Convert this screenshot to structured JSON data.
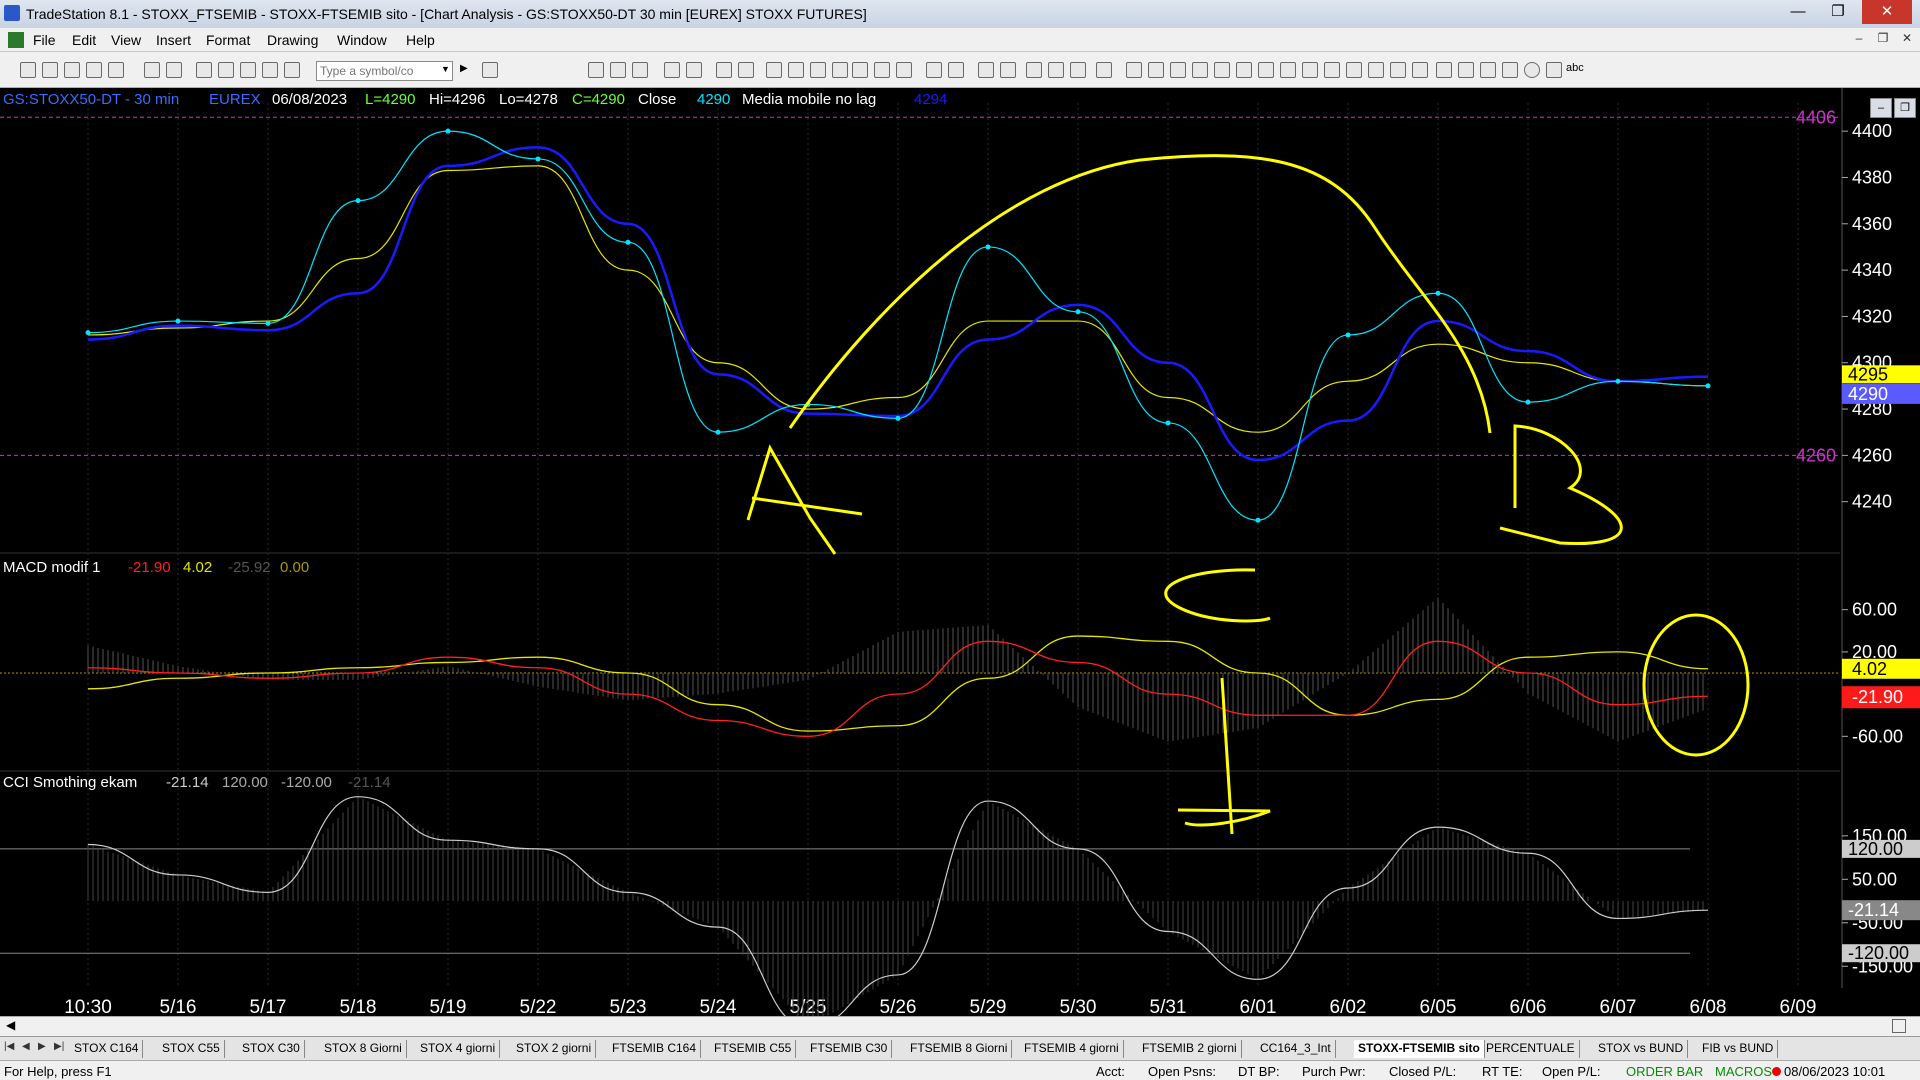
{
  "window": {
    "title": "TradeStation 8.1 - STOXX_FTSEMIB - STOXX-FTSEMIB sito - [Chart Analysis - GS:STOXX50-DT  30 min  [EUREX] STOXX FUTURES]",
    "minimize": "—",
    "maximize": "❐",
    "close": "✕"
  },
  "menu": [
    "File",
    "Edit",
    "View",
    "Insert",
    "Format",
    "Drawing",
    "Window",
    "Help"
  ],
  "mdi_controls": [
    "–",
    "❐",
    "✕"
  ],
  "toolbar": {
    "symbol_placeholder": "Type a symbol/co",
    "text_tool": "abc"
  },
  "chart_header": {
    "symbol": "GS:STOXX50-DT - 30 min",
    "exchange": "EUREX",
    "date": "06/08/2023",
    "last": "L=4290",
    "high": "Hi=4296",
    "low": "Lo=4278",
    "close": "C=4290",
    "close_label": "Close",
    "close_value": "4290",
    "study": "Media mobile no lag",
    "study_value": "4294"
  },
  "macd_header": {
    "name": "MACD modif 1",
    "v1": "-21.90",
    "v2": "4.02",
    "v3": "-25.92",
    "v4": "0.00"
  },
  "cci_header": {
    "name": "CCI Smothing ekam",
    "v1": "-21.14",
    "v2": "120.00",
    "v3": "-120.00",
    "v4": "-21.14"
  },
  "colors": {
    "price": "#00e5ff",
    "ma_fast": "#1a1aff",
    "ma_slow": "#e6e600",
    "macd": "#ff2020",
    "signal": "#e6e600",
    "cci_up": "#ff2020",
    "cci_down": "#19c9d8",
    "annotation": "#ffff00",
    "ref_level": "#cc33cc"
  },
  "chart_data": [
    {
      "type": "line",
      "title": "GS:STOXX50-DT - 30 min",
      "x": [
        "10:30",
        "5/16",
        "5/17",
        "5/18",
        "5/19",
        "5/22",
        "5/23",
        "5/24",
        "5/25",
        "5/26",
        "5/29",
        "5/30",
        "5/31",
        "6/01",
        "6/02",
        "6/05",
        "6/06",
        "6/07",
        "6/08",
        "6/09"
      ],
      "series": [
        {
          "name": "Close",
          "values": [
            4313,
            4318,
            4317,
            4370,
            4400,
            4388,
            4352,
            4270,
            4282,
            4276,
            4350,
            4322,
            4274,
            4232,
            4312,
            4330,
            4283,
            4292,
            4290,
            null
          ]
        },
        {
          "name": "Media mobile no lag",
          "values": [
            4310,
            4316,
            4314,
            4330,
            4385,
            4393,
            4360,
            4295,
            4278,
            4277,
            4310,
            4325,
            4300,
            4258,
            4275,
            4318,
            4305,
            4292,
            4294,
            null
          ]
        },
        {
          "values": [
            4312,
            4315,
            4318,
            4345,
            4383,
            4385,
            4340,
            4300,
            4280,
            4285,
            4318,
            4318,
            4285,
            4270,
            4292,
            4308,
            4300,
            4292,
            4290,
            null
          ]
        }
      ],
      "ylim": [
        4220,
        4410
      ],
      "y_ticks": [
        4240,
        4260,
        4280,
        4300,
        4320,
        4340,
        4360,
        4380,
        4400
      ],
      "reference_lines": [
        4260,
        4406
      ],
      "price_labels": [
        "4406",
        "4260",
        "4295",
        "4290"
      ]
    },
    {
      "type": "line",
      "title": "MACD modif 1",
      "series": [
        {
          "values": [
            5,
            0,
            -5,
            0,
            15,
            5,
            -20,
            -45,
            -60,
            -20,
            30,
            10,
            -20,
            -40,
            -40,
            30,
            0,
            -30,
            -22
          ]
        },
        {
          "values": [
            -15,
            -5,
            0,
            5,
            10,
            15,
            0,
            -30,
            -55,
            -50,
            -5,
            35,
            30,
            0,
            -40,
            -25,
            15,
            20,
            4
          ]
        }
      ],
      "ylim": [
        -90,
        90
      ],
      "y_ticks": [
        "60.00",
        "20.00",
        "-60.00"
      ],
      "value_labels": [
        "4.02",
        "-21.90"
      ]
    },
    {
      "type": "line",
      "title": "CCI Smothing ekam",
      "series": [
        {
          "values": [
            130,
            60,
            20,
            240,
            140,
            120,
            20,
            -60,
            -290,
            -170,
            230,
            120,
            -70,
            -180,
            30,
            170,
            110,
            -40,
            -21
          ]
        }
      ],
      "ylim": [
        -200,
        260
      ],
      "y_ticks": [
        "150.00",
        "120.00",
        "50.00",
        "-50.00",
        "-120.00",
        "-150.00"
      ],
      "value_labels": [
        "-21.14",
        "120.00",
        "-120.00"
      ]
    }
  ],
  "annotations": [
    "A",
    "B",
    "C",
    "D"
  ],
  "tabs": [
    "STOX C164",
    "STOX C55",
    "STOX  C30",
    "STOX  8 Giorni",
    "STOX 4 giorni",
    "STOX  2 giorni",
    "FTSEMIB C164",
    "FTSEMIB C55",
    "FTSEMIB C30",
    "FTSEMIB  8 Giorni",
    "FTSEMIB  4 giorni",
    "FTSEMIB  2 giorni",
    "CC164_3_Int",
    "STOXX-FTSEMIB sito",
    "PERCENTUALE",
    "STOX vs BUND",
    "FIB vs BUND"
  ],
  "active_tab": "STOXX-FTSEMIB sito",
  "status": {
    "help": "For Help, press F1",
    "acct": "Acct:",
    "open_psns": "Open Psns:",
    "dt_bp": "DT BP:",
    "purch_pwr": "Purch Pwr:",
    "closed_pl": "Closed P/L:",
    "rt_te": "RT TE:",
    "open_pl": "Open P/L:",
    "order_bar": "ORDER BAR",
    "macros": "MACROS",
    "datetime": "08/06/2023 10:01"
  }
}
